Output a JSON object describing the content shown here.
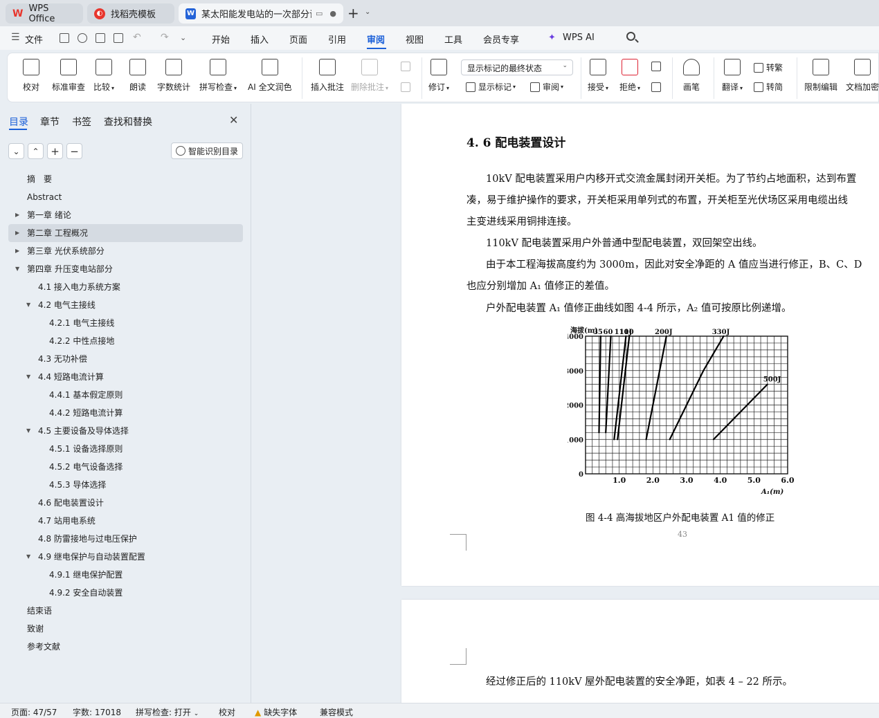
{
  "tabs": [
    {
      "label": "WPS Office",
      "icon": "wps-logo-icon",
      "color": "#e8362d"
    },
    {
      "label": "找稻壳模板",
      "icon": "docer-icon",
      "color": "#e8362d"
    },
    {
      "label": "某太阳能发电站的一次部分设",
      "icon": "word-doc-icon",
      "color": "#2463d8"
    }
  ],
  "menu": {
    "file": "文件",
    "items": [
      "开始",
      "插入",
      "页面",
      "引用",
      "审阅",
      "视图",
      "工具",
      "会员专享"
    ],
    "active": "审阅",
    "wps_ai": "WPS AI"
  },
  "ribbon": {
    "proofread": "校对",
    "standard_review": "标准审查",
    "compare": "比较",
    "read_aloud": "朗读",
    "word_count": "字数统计",
    "spell_check": "拼写检查",
    "ai_proofread": "AI 全文润色",
    "insert_comment": "插入批注",
    "delete_comment": "删除批注",
    "track_changes": "修订",
    "show_markup": "显示标记",
    "review": "审阅",
    "status_select": "显示标记的最终状态",
    "accept": "接受",
    "reject": "拒绝",
    "brush": "画笔",
    "translate": "翻译",
    "trad_to_simp": "转繁",
    "simp_to_trad": "转简",
    "restrict_edit": "限制编辑",
    "doc_encrypt": "文档加密"
  },
  "nav": {
    "tabs": [
      "目录",
      "章节",
      "书签",
      "查找和替换"
    ],
    "active_tab": "目录",
    "smart_toc": "智能识别目录",
    "toc": [
      {
        "label": "摘　要",
        "level": 0,
        "caret": ""
      },
      {
        "label": "Abstract",
        "level": 0,
        "caret": ""
      },
      {
        "label": "第一章  绪论",
        "level": 0,
        "caret": "▶"
      },
      {
        "label": "第二章  工程概况",
        "level": 0,
        "caret": "▶",
        "selected": true
      },
      {
        "label": "第三章  光伏系统部分",
        "level": 0,
        "caret": "▶"
      },
      {
        "label": "第四章  升压变电站部分",
        "level": 0,
        "caret": "▼"
      },
      {
        "label": "4.1  接入电力系统方案",
        "level": 1,
        "caret": ""
      },
      {
        "label": "4.2  电气主接线",
        "level": 1,
        "caret": "▼"
      },
      {
        "label": "4.2.1  电气主接线",
        "level": 2,
        "caret": ""
      },
      {
        "label": "4.2.2  中性点接地",
        "level": 2,
        "caret": ""
      },
      {
        "label": "4.3  无功补偿",
        "level": 1,
        "caret": ""
      },
      {
        "label": "4.4  短路电流计算",
        "level": 1,
        "caret": "▼"
      },
      {
        "label": "4.4.1 基本假定原则",
        "level": 2,
        "caret": ""
      },
      {
        "label": "4.4.2  短路电流计算",
        "level": 2,
        "caret": ""
      },
      {
        "label": "4.5  主要设备及导体选择",
        "level": 1,
        "caret": "▼"
      },
      {
        "label": "4.5.1  设备选择原则",
        "level": 2,
        "caret": ""
      },
      {
        "label": "4.5.2  电气设备选择",
        "level": 2,
        "caret": ""
      },
      {
        "label": "4.5.3  导体选择",
        "level": 2,
        "caret": ""
      },
      {
        "label": "4.6  配电装置设计",
        "level": 1,
        "caret": ""
      },
      {
        "label": "4.7  站用电系统",
        "level": 1,
        "caret": ""
      },
      {
        "label": "4.8  防雷接地与过电压保护",
        "level": 1,
        "caret": ""
      },
      {
        "label": "4.9  继电保护与自动装置配置",
        "level": 1,
        "caret": "▼"
      },
      {
        "label": "4.9.1  继电保护配置",
        "level": 2,
        "caret": ""
      },
      {
        "label": "4.9.2  安全自动装置",
        "level": 2,
        "caret": ""
      },
      {
        "label": "结束语",
        "level": 0,
        "caret": ""
      },
      {
        "label": "致谢",
        "level": 0,
        "caret": ""
      },
      {
        "label": "参考文献",
        "level": 0,
        "caret": ""
      }
    ]
  },
  "document": {
    "heading": "4. 6  配电装置设计",
    "paragraphs": [
      "10kV 配电装置采用户内移开式交流金属封闭开关柜。为了节约占地面积，达到布置",
      "凑，易于维护操作的要求，开关柜采用单列式的布置，开关柜至光伏场区采用电缆出线",
      "主变进线采用铜排连接。",
      "110kV 配电装置采用户外普通中型配电装置，双回架空出线。",
      "由于本工程海拔高度约为 3000m，因此对安全净距的 A 值应当进行修正，B、C、D",
      "也应分别增加 A₁ 值修正的差值。",
      "户外配电装置 A₁ 值修正曲线如图 4-4 所示，A₂ 值可按原比例递增。"
    ],
    "caption": "图 4-4  高海拔地区户外配电装置 A1 值的修正",
    "page_number": "43",
    "page2_text": "经过修正后的 110kV 屋外配电装置的安全净距，如表 4 – 22 所示。"
  },
  "chart_data": {
    "type": "line",
    "ylabel": "海拔(m)",
    "xlabel": "A₁(m)",
    "x_ticks": [
      "1.0",
      "2.0",
      "3.0",
      "4.0",
      "5.0",
      "6.0"
    ],
    "y_ticks": [
      "0",
      "1000",
      "2000",
      "3000",
      "4000"
    ],
    "xlim": [
      0.0,
      6.0
    ],
    "ylim": [
      0,
      4000
    ],
    "grid": true,
    "series": [
      {
        "name": "35",
        "points": [
          [
            0.4,
            1200
          ],
          [
            0.45,
            4000
          ]
        ]
      },
      {
        "name": "60",
        "points": [
          [
            0.6,
            1200
          ],
          [
            0.75,
            4000
          ]
        ]
      },
      {
        "name": "110J",
        "points": [
          [
            0.85,
            1000
          ],
          [
            1.2,
            4000
          ]
        ]
      },
      {
        "name": "110",
        "points": [
          [
            0.95,
            1000
          ],
          [
            1.3,
            4000
          ]
        ]
      },
      {
        "name": "200J",
        "points": [
          [
            1.8,
            1000
          ],
          [
            2.4,
            4000
          ]
        ]
      },
      {
        "name": "330J",
        "points": [
          [
            2.5,
            1000
          ],
          [
            3.5,
            3000
          ],
          [
            4.1,
            4000
          ]
        ]
      },
      {
        "name": "500J",
        "points": [
          [
            3.8,
            1000
          ],
          [
            4.8,
            2000
          ],
          [
            5.4,
            2600
          ]
        ]
      }
    ]
  },
  "statusbar": {
    "page": "页面: 47/57",
    "word_count": "字数: 17018",
    "spell_check": "拼写检查: 打开",
    "proofread": "校对",
    "missing_font": "缺失字体",
    "compat_mode": "兼容模式"
  }
}
